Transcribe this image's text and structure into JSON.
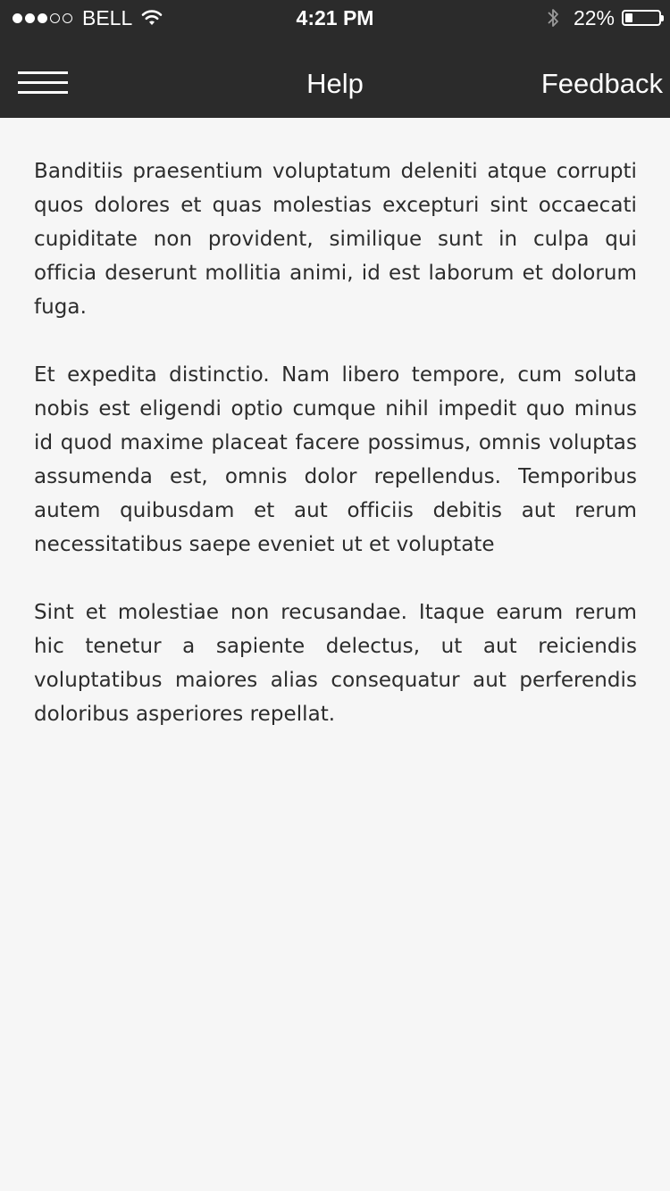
{
  "status_bar": {
    "signal_dots": [
      "full",
      "full",
      "full",
      "empty",
      "empty"
    ],
    "carrier": "BELL",
    "time": "4:21 PM",
    "battery_percent": "22%",
    "battery_level": 0.22,
    "icons": [
      "signal-icon",
      "wifi-icon",
      "bluetooth-icon",
      "battery-icon"
    ]
  },
  "nav": {
    "menu_icon": "hamburger-menu-icon",
    "title": "Help",
    "right_button": "Feedback"
  },
  "content": {
    "paragraphs": [
      "Banditiis praesentium voluptatum deleniti atque corrupti quos dolores et quas molestias excepturi sint occaecati cupiditate non provident, similique sunt in culpa qui officia deserunt mollitia animi, id est laborum et dolorum fuga.",
      "Et expedita distinctio. Nam libero tempore, cum soluta nobis est eligendi optio cumque nihil impedit quo minus id quod maxime placeat facere possimus, omnis voluptas assumenda est, omnis dolor repellendus. Temporibus autem quibusdam et aut officiis debitis aut rerum necessitatibus saepe eveniet ut et voluptate",
      "Sint et molestiae non recusandae. Itaque earum rerum hic tenetur a sapiente delectus, ut aut reiciendis voluptatibus maiores alias consequatur aut perferendis doloribus asperiores repellat."
    ]
  },
  "colors": {
    "top_bar": "#2b2b2b",
    "background": "#f6f6f6",
    "text": "#2c2c2c",
    "bar_text": "#ffffff"
  }
}
